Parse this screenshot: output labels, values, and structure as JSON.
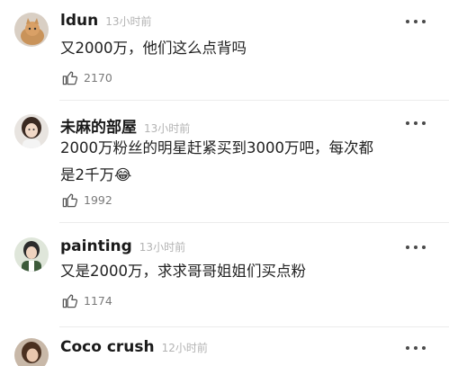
{
  "comments": [
    {
      "username": "ldun",
      "time": "13小时前",
      "text_lines": [
        "又2000万，他们这么点背吗"
      ],
      "likes": "2170",
      "avatar_icon": "cat-photo-avatar"
    },
    {
      "username": "未麻的部屋",
      "time": "13小时前",
      "text_lines": [
        "2000万粉丝的明星赶紧买到3000万吧，每次都",
        "是2千万"
      ],
      "emoji": "😂",
      "likes": "1992",
      "avatar_icon": "girl-photo-avatar"
    },
    {
      "username": "painting",
      "time": "13小时前",
      "text_lines": [
        "又是2000万，求求哥哥姐姐们买点粉"
      ],
      "likes": "1174",
      "avatar_icon": "person-photo-avatar"
    },
    {
      "username": "Coco crush",
      "time": "12小时前",
      "text_lines": [],
      "likes": "",
      "avatar_icon": "woman-photo-avatar"
    }
  ],
  "icons": {
    "like": "thumbs-up-icon",
    "more": "more-options-icon"
  },
  "colors": {
    "text": "#1a1a1a",
    "meta": "#b3b3b3",
    "like_count": "#7a7a7a"
  }
}
